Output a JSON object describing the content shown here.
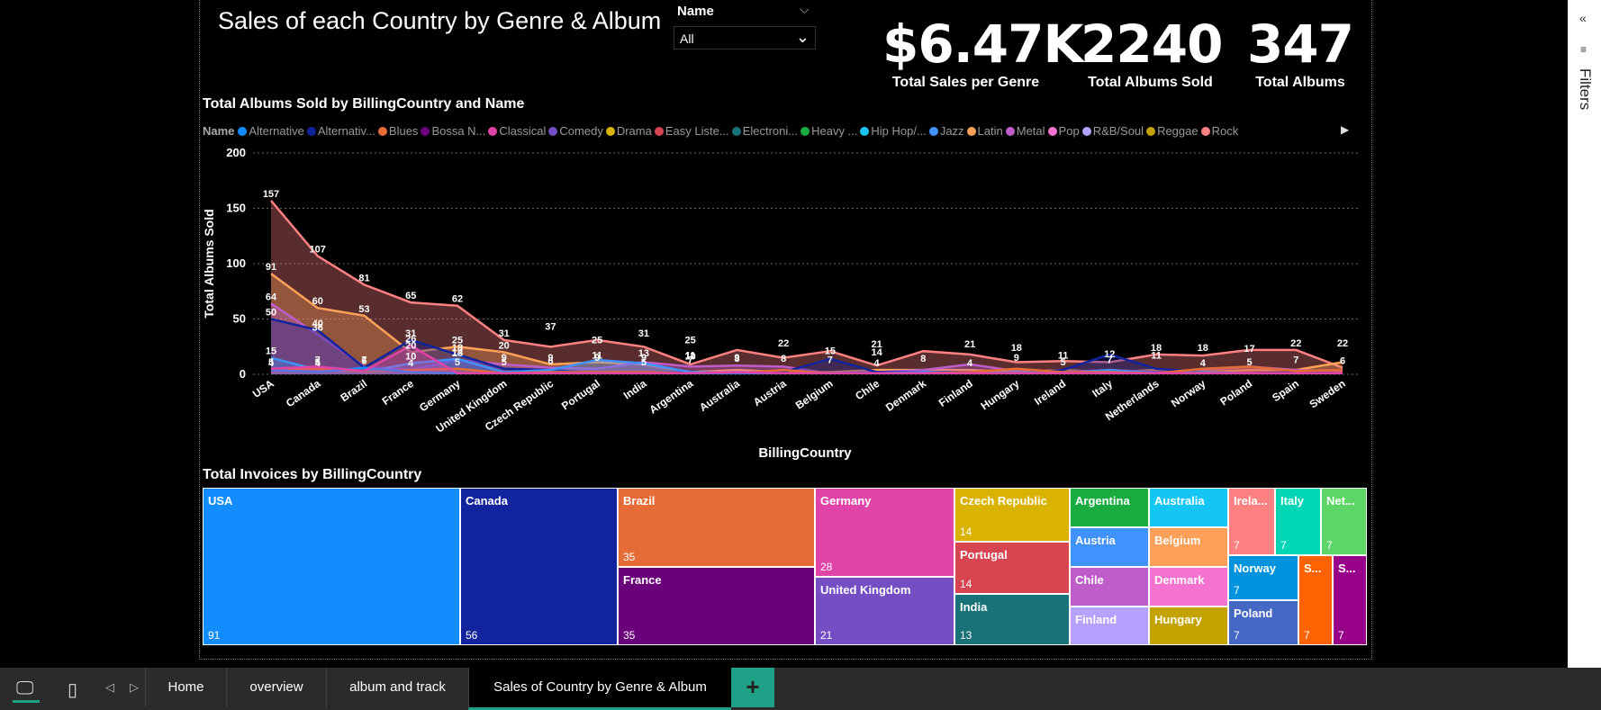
{
  "report": {
    "title": "Sales of each Country by Genre & Album",
    "slicer": {
      "label": "Name",
      "value": "All"
    },
    "kpis": [
      {
        "value": "$6.47K",
        "label": "Total Sales per Genre"
      },
      {
        "value": "2240",
        "label": "Total Albums Sold"
      },
      {
        "value": "347",
        "label": "Total Albums"
      }
    ]
  },
  "legend": {
    "title": "Name",
    "items": [
      {
        "label": "Alternative",
        "color": "#118DFF"
      },
      {
        "label": "Alternativ...",
        "color": "#12239E"
      },
      {
        "label": "Blues",
        "color": "#E66C37"
      },
      {
        "label": "Bossa N...",
        "color": "#6B007B"
      },
      {
        "label": "Classical",
        "color": "#E044A7"
      },
      {
        "label": "Comedy",
        "color": "#744EC2"
      },
      {
        "label": "Drama",
        "color": "#D9B300"
      },
      {
        "label": "Easy Liste...",
        "color": "#D64550"
      },
      {
        "label": "Electroni...",
        "color": "#197278"
      },
      {
        "label": "Heavy ...",
        "color": "#1AAB40"
      },
      {
        "label": "Hip Hop/...",
        "color": "#15C6F4"
      },
      {
        "label": "Jazz",
        "color": "#4092FF"
      },
      {
        "label": "Latin",
        "color": "#FFA058"
      },
      {
        "label": "Metal",
        "color": "#BE5DC9"
      },
      {
        "label": "Pop",
        "color": "#F472D0"
      },
      {
        "label": "R&B/Soul",
        "color": "#B5A1FF"
      },
      {
        "label": "Reggae",
        "color": "#C4A200"
      },
      {
        "label": "Rock",
        "color": "#FF8080"
      }
    ]
  },
  "chart_title": "Total Albums Sold by BillingCountry and Name",
  "chart_data": {
    "type": "area",
    "xlabel": "BillingCountry",
    "ylabel": "Total Albums Sold",
    "ylim": [
      0,
      200
    ],
    "yticks": [
      0,
      50,
      100,
      150,
      200
    ],
    "grid": true,
    "legend_position": "top",
    "categories": [
      "USA",
      "Canada",
      "Brazil",
      "France",
      "Germany",
      "United Kingdom",
      "Czech Republic",
      "Portugal",
      "India",
      "Argentina",
      "Australia",
      "Austria",
      "Belgium",
      "Chile",
      "Denmark",
      "Finland",
      "Hungary",
      "Ireland",
      "Italy",
      "Netherlands",
      "Norway",
      "Poland",
      "Spain",
      "Sweden"
    ],
    "series": [
      {
        "name": "Rock",
        "color": "#FF8080",
        "values": [
          157,
          107,
          81,
          65,
          62,
          31,
          25,
          31,
          25,
          9,
          22,
          15,
          21,
          8,
          21,
          18,
          11,
          12,
          11,
          18,
          17,
          22,
          22,
          6
        ]
      },
      {
        "name": "Latin",
        "color": "#FFA058",
        "values": [
          91,
          60,
          53,
          20,
          25,
          20,
          9,
          11,
          9,
          2,
          4,
          2,
          2,
          4,
          4,
          4,
          2,
          4,
          2,
          4,
          2,
          4,
          4,
          11
        ]
      },
      {
        "name": "Metal",
        "color": "#BE5DC9",
        "values": [
          64,
          36,
          7,
          4,
          13,
          9,
          6,
          5,
          11,
          7,
          8,
          7,
          1,
          2,
          4,
          9,
          3,
          2,
          4,
          2,
          4,
          7,
          4,
          2
        ]
      },
      {
        "name": "Alternativ...",
        "color": "#12239E",
        "values": [
          50,
          40,
          6,
          31,
          18,
          5,
          4,
          1,
          1,
          2,
          1,
          2,
          14,
          2,
          2,
          2,
          1,
          4,
          18,
          5,
          2,
          1,
          2,
          1
        ]
      },
      {
        "name": "Jazz",
        "color": "#4092FF",
        "values": [
          15,
          4,
          2,
          10,
          14,
          2,
          4,
          13,
          10,
          2,
          1,
          1,
          1,
          1,
          2,
          1,
          2,
          1,
          4,
          1,
          2,
          1,
          1,
          1
        ]
      },
      {
        "name": "Blues",
        "color": "#E66C37",
        "values": [
          5,
          5,
          2,
          4,
          5,
          1,
          2,
          2,
          2,
          1,
          1,
          4,
          1,
          1,
          1,
          2,
          5,
          2,
          2,
          1,
          5,
          7,
          3,
          4
        ]
      },
      {
        "name": "Alternative",
        "color": "#118DFF",
        "values": [
          4,
          2,
          6,
          2,
          1,
          1,
          1,
          1,
          1,
          1,
          1,
          1,
          1,
          1,
          1,
          1,
          1,
          1,
          1,
          1,
          1,
          1,
          1,
          1
        ]
      },
      {
        "name": "Classical",
        "color": "#E044A7",
        "values": [
          5,
          7,
          3,
          26,
          1,
          1,
          1,
          1,
          1,
          1,
          2,
          1,
          1,
          1,
          1,
          1,
          1,
          1,
          1,
          1,
          1,
          1,
          1,
          1
        ]
      }
    ],
    "data_labels": [
      {
        "x": "USA",
        "y": 157,
        "text": "157"
      },
      {
        "x": "USA",
        "y": 91,
        "text": "91"
      },
      {
        "x": "USA",
        "y": 64,
        "text": "64"
      },
      {
        "x": "USA",
        "y": 50,
        "text": "50"
      },
      {
        "x": "USA",
        "y": 15,
        "text": "15"
      },
      {
        "x": "USA",
        "y": 5,
        "text": "5"
      },
      {
        "x": "USA",
        "y": 4,
        "text": "4"
      },
      {
        "x": "Canada",
        "y": 107,
        "text": "107"
      },
      {
        "x": "Canada",
        "y": 60,
        "text": "60"
      },
      {
        "x": "Canada",
        "y": 36,
        "text": "36"
      },
      {
        "x": "Canada",
        "y": 40,
        "text": "40"
      },
      {
        "x": "Canada",
        "y": 4,
        "text": "4"
      },
      {
        "x": "Canada",
        "y": 5,
        "text": "5"
      },
      {
        "x": "Canada",
        "y": 7,
        "text": "7"
      },
      {
        "x": "Brazil",
        "y": 81,
        "text": "81"
      },
      {
        "x": "Brazil",
        "y": 53,
        "text": "53"
      },
      {
        "x": "Brazil",
        "y": 7,
        "text": "7"
      },
      {
        "x": "Brazil",
        "y": 6,
        "text": "6"
      },
      {
        "x": "France",
        "y": 65,
        "text": "65"
      },
      {
        "x": "France",
        "y": 31,
        "text": "31"
      },
      {
        "x": "France",
        "y": 20,
        "text": "20"
      },
      {
        "x": "France",
        "y": 26,
        "text": "26"
      },
      {
        "x": "France",
        "y": 10,
        "text": "10"
      },
      {
        "x": "France",
        "y": 4,
        "text": "4"
      },
      {
        "x": "Germany",
        "y": 62,
        "text": "62"
      },
      {
        "x": "Germany",
        "y": 25,
        "text": "25"
      },
      {
        "x": "Germany",
        "y": 13,
        "text": "13"
      },
      {
        "x": "Germany",
        "y": 18,
        "text": "18"
      },
      {
        "x": "Germany",
        "y": 14,
        "text": "14"
      },
      {
        "x": "Germany",
        "y": 5,
        "text": "5"
      },
      {
        "x": "United Kingdom",
        "y": 31,
        "text": "31"
      },
      {
        "x": "United Kingdom",
        "y": 20,
        "text": "20"
      },
      {
        "x": "United Kingdom",
        "y": 9,
        "text": "9"
      },
      {
        "x": "United Kingdom",
        "y": 5,
        "text": "5"
      },
      {
        "x": "Czech Republic",
        "y": 37,
        "text": "37"
      },
      {
        "x": "Czech Republic",
        "y": 9,
        "text": "9"
      },
      {
        "x": "Czech Republic",
        "y": 6,
        "text": "6"
      },
      {
        "x": "Portugal",
        "y": 25,
        "text": "25"
      },
      {
        "x": "Portugal",
        "y": 9,
        "text": "9"
      },
      {
        "x": "Portugal",
        "y": 11,
        "text": "11"
      },
      {
        "x": "India",
        "y": 31,
        "text": "31"
      },
      {
        "x": "India",
        "y": 5,
        "text": "5"
      },
      {
        "x": "India",
        "y": 13,
        "text": "13"
      },
      {
        "x": "India",
        "y": 9,
        "text": "9"
      },
      {
        "x": "Argentina",
        "y": 25,
        "text": "25"
      },
      {
        "x": "Argentina",
        "y": 11,
        "text": "11"
      },
      {
        "x": "Argentina",
        "y": 10,
        "text": "10"
      },
      {
        "x": "Argentina",
        "y": 7,
        "text": "7"
      },
      {
        "x": "Australia",
        "y": 9,
        "text": "9"
      },
      {
        "x": "Australia",
        "y": 8,
        "text": "8"
      },
      {
        "x": "Austria",
        "y": 22,
        "text": "22"
      },
      {
        "x": "Austria",
        "y": 8,
        "text": "8"
      },
      {
        "x": "Belgium",
        "y": 15,
        "text": "15"
      },
      {
        "x": "Belgium",
        "y": 7,
        "text": "7"
      },
      {
        "x": "Chile",
        "y": 21,
        "text": "21"
      },
      {
        "x": "Chile",
        "y": 14,
        "text": "14"
      },
      {
        "x": "Chile",
        "y": 4,
        "text": "4"
      },
      {
        "x": "Denmark",
        "y": 8,
        "text": "8"
      },
      {
        "x": "Finland",
        "y": 21,
        "text": "21"
      },
      {
        "x": "Finland",
        "y": 4,
        "text": "4"
      },
      {
        "x": "Hungary",
        "y": 18,
        "text": "18"
      },
      {
        "x": "Hungary",
        "y": 9,
        "text": "9"
      },
      {
        "x": "Ireland",
        "y": 11,
        "text": "11"
      },
      {
        "x": "Ireland",
        "y": 5,
        "text": "5"
      },
      {
        "x": "Italy",
        "y": 12,
        "text": "12"
      },
      {
        "x": "Italy",
        "y": 7,
        "text": "7"
      },
      {
        "x": "Netherlands",
        "y": 11,
        "text": "11"
      },
      {
        "x": "Netherlands",
        "y": 18,
        "text": "18"
      },
      {
        "x": "Norway",
        "y": 18,
        "text": "18"
      },
      {
        "x": "Norway",
        "y": 4,
        "text": "4"
      },
      {
        "x": "Poland",
        "y": 17,
        "text": "17"
      },
      {
        "x": "Poland",
        "y": 5,
        "text": "5"
      },
      {
        "x": "Spain",
        "y": 22,
        "text": "22"
      },
      {
        "x": "Spain",
        "y": 7,
        "text": "7"
      },
      {
        "x": "Sweden",
        "y": 22,
        "text": "22"
      },
      {
        "x": "Sweden",
        "y": 6,
        "text": "6"
      }
    ]
  },
  "treemap_title": "Total Invoices by BillingCountry",
  "treemap": {
    "type": "treemap",
    "tiles": [
      {
        "name": "USA",
        "value": 91,
        "color": "#118DFF"
      },
      {
        "name": "Canada",
        "value": 56,
        "color": "#12239E"
      },
      {
        "name": "Brazil",
        "value": 35,
        "color": "#E66C37"
      },
      {
        "name": "France",
        "value": 35,
        "color": "#6B007B"
      },
      {
        "name": "Germany",
        "value": 28,
        "color": "#E044A7"
      },
      {
        "name": "United Kingdom",
        "value": 21,
        "color": "#744EC2"
      },
      {
        "name": "Czech Republic",
        "value": 14,
        "color": "#D9B300"
      },
      {
        "name": "Portugal",
        "value": 14,
        "color": "#D64550"
      },
      {
        "name": "India",
        "value": 13,
        "color": "#197278"
      },
      {
        "name": "Argentina",
        "value": null,
        "color": "#1AAB40"
      },
      {
        "name": "Australia",
        "value": null,
        "color": "#15C6F4"
      },
      {
        "name": "Austria",
        "value": null,
        "color": "#4092FF"
      },
      {
        "name": "Belgium",
        "value": null,
        "color": "#FFA058"
      },
      {
        "name": "Chile",
        "value": null,
        "color": "#BE5DC9"
      },
      {
        "name": "Denmark",
        "value": null,
        "color": "#F472D0"
      },
      {
        "name": "Finland",
        "value": null,
        "color": "#B5A1FF"
      },
      {
        "name": "Hungary",
        "value": null,
        "color": "#C4A200"
      },
      {
        "name": "Irela...",
        "value": 7,
        "color": "#FF8080"
      },
      {
        "name": "Italy",
        "value": 7,
        "color": "#00D6B6"
      },
      {
        "name": "Net...",
        "value": 7,
        "color": "#5BD667"
      },
      {
        "name": "Norway",
        "value": 7,
        "color": "#0093DD"
      },
      {
        "name": "Poland",
        "value": 7,
        "color": "#4668C5"
      },
      {
        "name": "S...",
        "value": 7,
        "color": "#FF6300"
      },
      {
        "name": "S...",
        "value": 7,
        "color": "#99008A"
      }
    ]
  },
  "filters_pane": {
    "label": "Filters"
  },
  "tabs": [
    {
      "label": "Home"
    },
    {
      "label": "overview"
    },
    {
      "label": "album and track"
    },
    {
      "label": "Sales of Country by Genre & Album"
    }
  ],
  "add_tab": "+"
}
